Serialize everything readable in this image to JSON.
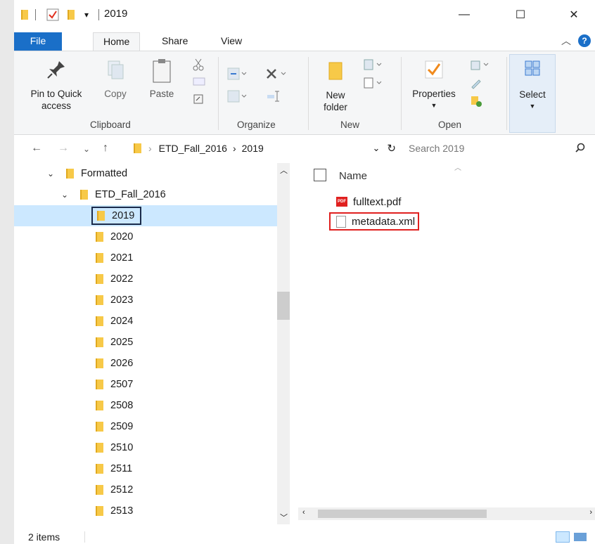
{
  "titlebar": {
    "title": "2019",
    "quick_access_arrow": "▾",
    "minimize": "—",
    "maximize": "☐",
    "close": "✕"
  },
  "ribbon_tabs": {
    "file": "File",
    "home": "Home",
    "share": "Share",
    "view": "View",
    "help": "?"
  },
  "ribbon": {
    "pin_line1": "Pin to Quick",
    "pin_line2": "access",
    "copy": "Copy",
    "paste": "Paste",
    "group_clipboard": "Clipboard",
    "group_organize": "Organize",
    "new_folder_line1": "New",
    "new_folder_line2": "folder",
    "group_new": "New",
    "properties": "Properties",
    "group_open": "Open",
    "select": "Select"
  },
  "address": {
    "crumbs": [
      "ETD_Fall_2016",
      "2019"
    ],
    "search_placeholder": "Search 2019"
  },
  "nav_tree": {
    "formatted": "Formatted",
    "etd": "ETD_Fall_2016",
    "folders": [
      "2019",
      "2020",
      "2021",
      "2022",
      "2023",
      "2024",
      "2025",
      "2026",
      "2507",
      "2508",
      "2509",
      "2510",
      "2511",
      "2512",
      "2513"
    ],
    "selected": "2019"
  },
  "content": {
    "column_name": "Name",
    "files": [
      {
        "name": "fulltext.pdf",
        "icon": "pdf-icon",
        "badge": "PDF"
      },
      {
        "name": "metadata.xml",
        "icon": "xml-file-icon",
        "highlighted": true
      }
    ]
  },
  "statusbar": {
    "item_count": "2 items"
  },
  "colors": {
    "accent": "#1a6fc8",
    "selection": "#cce8ff",
    "folder": "#f7c948",
    "highlight_red": "#e0201f",
    "highlight_dark": "#1a2a4a"
  }
}
